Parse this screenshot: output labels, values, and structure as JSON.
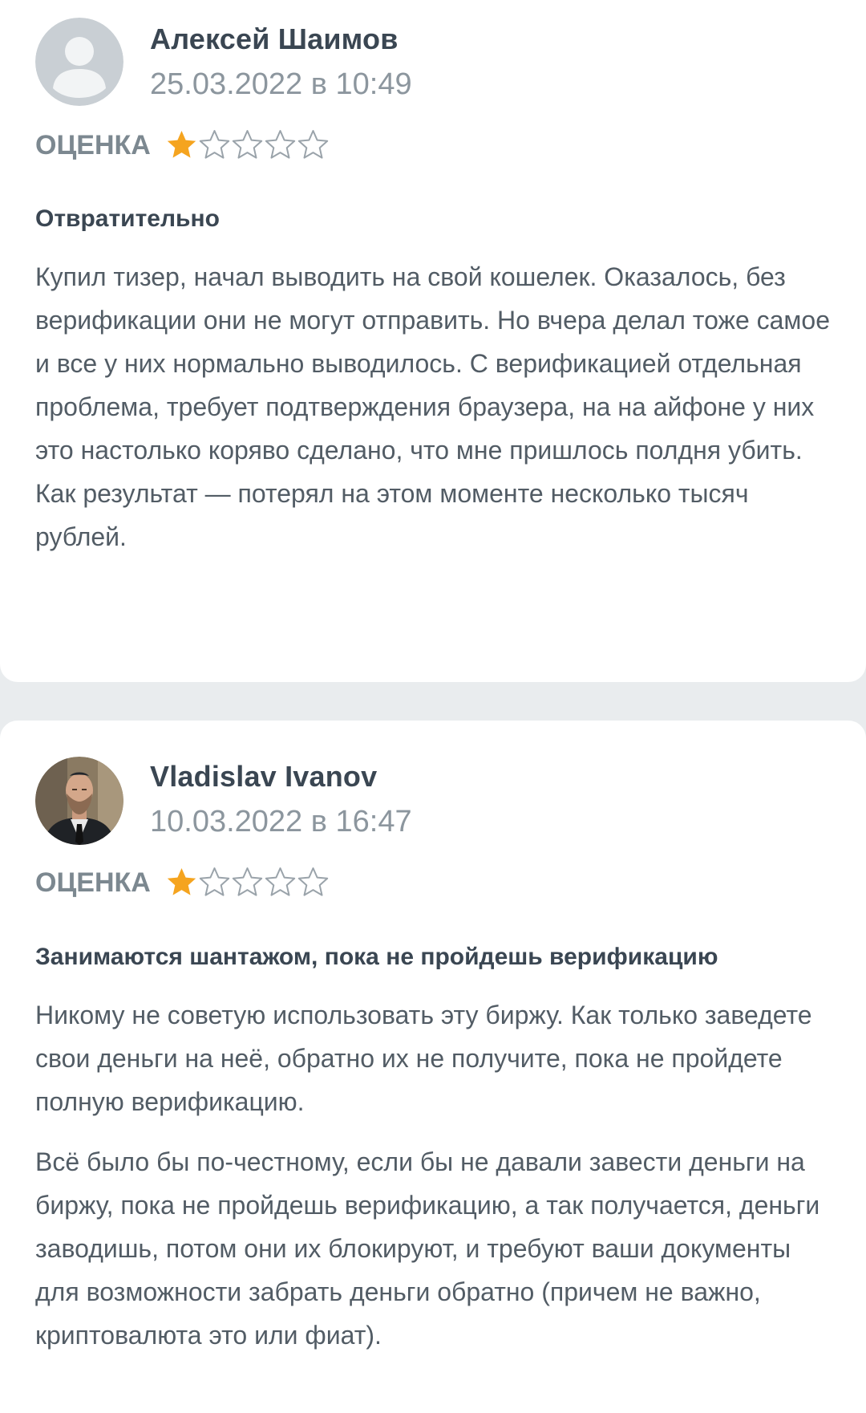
{
  "reviews": [
    {
      "author": "Алексей Шаимов",
      "date": "25.03.2022 в 10:49",
      "rating_label": "ОЦЕНКА",
      "rating": 1,
      "rating_max": 5,
      "title": "Отвратительно",
      "paragraphs": [
        "Купил тизер, начал выводить на свой кошелек. Оказалось, без верификации они не могут отправить. Но вчера делал тоже самое и все у них нормально выводилось. С верификацией отдельная проблема, требует подтверждения браузера, на на айфоне у них это настолько коряво сделано, что мне пришлось полдня убить. Как результат — потерял на этом моменте несколько тысяч рублей."
      ]
    },
    {
      "author": "Vladislav Ivanov",
      "date": "10.03.2022 в 16:47",
      "rating_label": "ОЦЕНКА",
      "rating": 1,
      "rating_max": 5,
      "title": "Занимаются шантажом, пока не пройдешь верификацию",
      "paragraphs": [
        "Никому не советую использовать эту биржу. Как только заведете свои деньги на неё, обратно их не получите, пока не пройдете полную верификацию.",
        "Всё было бы по-честному, если бы не давали завести деньги на биржу, пока не пройдешь верификацию, а так получается, деньги заводишь, потом они их блокируют, и требуют ваши документы для возможности забрать деньги обратно (причем не важно, криптовалюта это или фиат)."
      ]
    }
  ],
  "colors": {
    "star_filled": "#f5a41f",
    "star_empty_stroke": "#9aa3aa",
    "card_bg": "#ffffff",
    "page_bg": "#e9ecee"
  },
  "icons": {
    "avatar_default": "user-silhouette-icon",
    "avatar_photo": "avatar-photo",
    "star_filled": "star-filled-icon",
    "star_empty": "star-outline-icon"
  }
}
